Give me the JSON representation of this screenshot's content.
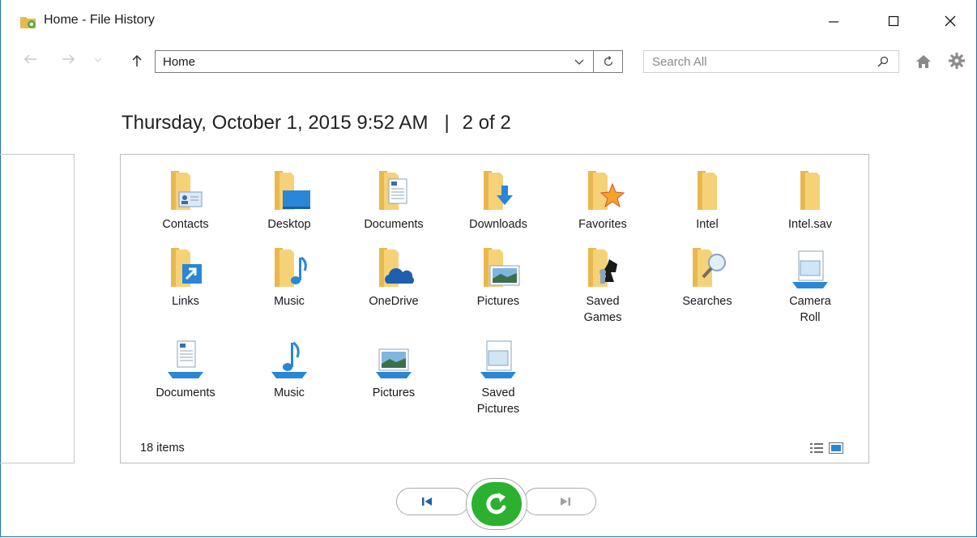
{
  "window": {
    "title": "Home - File History"
  },
  "toolbar": {
    "address_value": "Home",
    "search_placeholder": "Search All"
  },
  "heading": {
    "date": "Thursday, October 1, 2015 9:52 AM",
    "separator": "|",
    "position": "2 of 2"
  },
  "items": [
    {
      "label": "Contacts",
      "icon": "folder-contacts-icon"
    },
    {
      "label": "Desktop",
      "icon": "folder-desktop-icon"
    },
    {
      "label": "Documents",
      "icon": "folder-documents-icon"
    },
    {
      "label": "Downloads",
      "icon": "folder-downloads-icon"
    },
    {
      "label": "Favorites",
      "icon": "folder-favorites-icon"
    },
    {
      "label": "Intel",
      "icon": "folder-icon"
    },
    {
      "label": "Intel.sav",
      "icon": "folder-icon"
    },
    {
      "label": "Links",
      "icon": "folder-links-icon"
    },
    {
      "label": "Music",
      "icon": "folder-music-icon"
    },
    {
      "label": "OneDrive",
      "icon": "folder-onedrive-icon"
    },
    {
      "label": "Pictures",
      "icon": "folder-pictures-icon"
    },
    {
      "label": "Saved\nGames",
      "icon": "folder-saved-games-icon"
    },
    {
      "label": "Searches",
      "icon": "folder-searches-icon"
    },
    {
      "label": "Camera\nRoll",
      "icon": "library-camera-roll-icon"
    },
    {
      "label": "Documents",
      "icon": "library-documents-icon"
    },
    {
      "label": "Music",
      "icon": "library-music-icon"
    },
    {
      "label": "Pictures",
      "icon": "library-pictures-icon"
    },
    {
      "label": "Saved\nPictures",
      "icon": "library-saved-pictures-icon"
    }
  ],
  "status": {
    "item_count": "18 items"
  },
  "colors": {
    "folder": "#f5d277",
    "accent_blue": "#2a86d6",
    "restore_green": "#2bb02f",
    "window_border": "#1f6fb5"
  }
}
